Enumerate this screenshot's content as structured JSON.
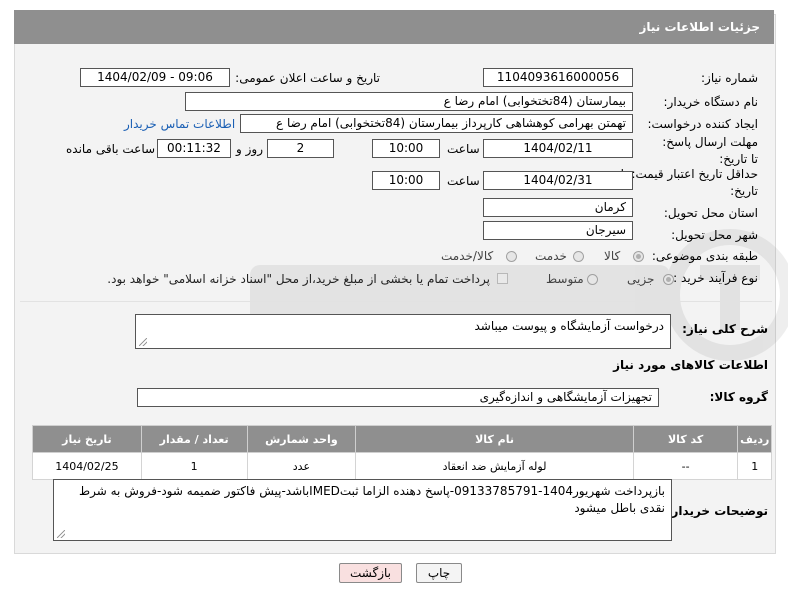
{
  "header": {
    "title": "جزئیات اطلاعات نیاز"
  },
  "form": {
    "need_number": {
      "label": "شماره نیاز:",
      "value": "1104093616000056"
    },
    "announce_datetime": {
      "label": "تاریخ و ساعت اعلان عمومی:",
      "value": "1404/02/09 - 09:06"
    },
    "buyer_org": {
      "label": "نام دستگاه خریدار:",
      "value": "بیمارستان (84تختخوابی) امام رضا  ع"
    },
    "requester": {
      "label": "ایجاد کننده درخواست:",
      "value": "تهمتن بهرامی کوهشاهی کارپرداز بیمارستان (84تختخوابی) امام رضا  ع",
      "contact_link": "اطلاعات تماس خریدار"
    },
    "reply_deadline": {
      "label": "مهلت ارسال پاسخ: تا تاریخ:",
      "date": "1404/02/11",
      "time_label": "ساعت",
      "time": "10:00",
      "days": "2",
      "days_label": "روز و",
      "remaining": "00:11:32",
      "remaining_label": "ساعت باقی مانده"
    },
    "price_validity": {
      "label": "حداقل تاریخ اعتبار قیمت: تا تاریخ:",
      "date": "1404/02/31",
      "time_label": "ساعت",
      "time": "10:00"
    },
    "delivery_province": {
      "label": "استان محل تحویل:",
      "value": "کرمان"
    },
    "delivery_city": {
      "label": "شهر محل تحویل:",
      "value": "سیرجان"
    },
    "category": {
      "label": "طبقه بندی موضوعی:",
      "options": [
        "کالا",
        "خدمت",
        "کالا/خدمت"
      ],
      "selected": "کالا"
    },
    "purchase_type": {
      "label": "نوع فرآیند خرید :",
      "options": [
        "جزیی",
        "متوسط"
      ],
      "selected": "جزیی",
      "payment_note": "پرداخت تمام یا بخشی از مبلغ خرید،از محل \"اسناد خزانه اسلامی\" خواهد بود."
    },
    "description": {
      "label": "شرح کلی نیاز:",
      "value": "درخواست آزمایشگاه و پیوست میباشد"
    }
  },
  "goods": {
    "section_title": "اطلاعات کالاهای مورد نیاز",
    "group_label": "گروه کالا:",
    "group_value": "تجهیزات آزمایشگاهی و اندازه‌گیری",
    "columns": [
      "ردیف",
      "کد کالا",
      "نام کالا",
      "واحد شمارش",
      "تعداد / مقدار",
      "تاریخ نیاز"
    ],
    "rows": [
      [
        "1",
        "--",
        "لوله آزمایش ضد انعقاد",
        "عدد",
        "1",
        "1404/02/25"
      ]
    ]
  },
  "buyer_notes": {
    "label": "توضیحات خریدار:",
    "value": "بازپرداخت شهریور1404-09133785791-پاسخ دهنده الزاما ثبتIMEDباشد-پیش فاکتور ضمیمه شود-فروش به شرط نقدی باطل میشود"
  },
  "buttons": {
    "print": "چاپ",
    "back": "بازگشت"
  },
  "colors": {
    "header_bg": "#8f8f8f",
    "link": "#1a5fb4",
    "back_button_bg": "#f9e0e0"
  }
}
